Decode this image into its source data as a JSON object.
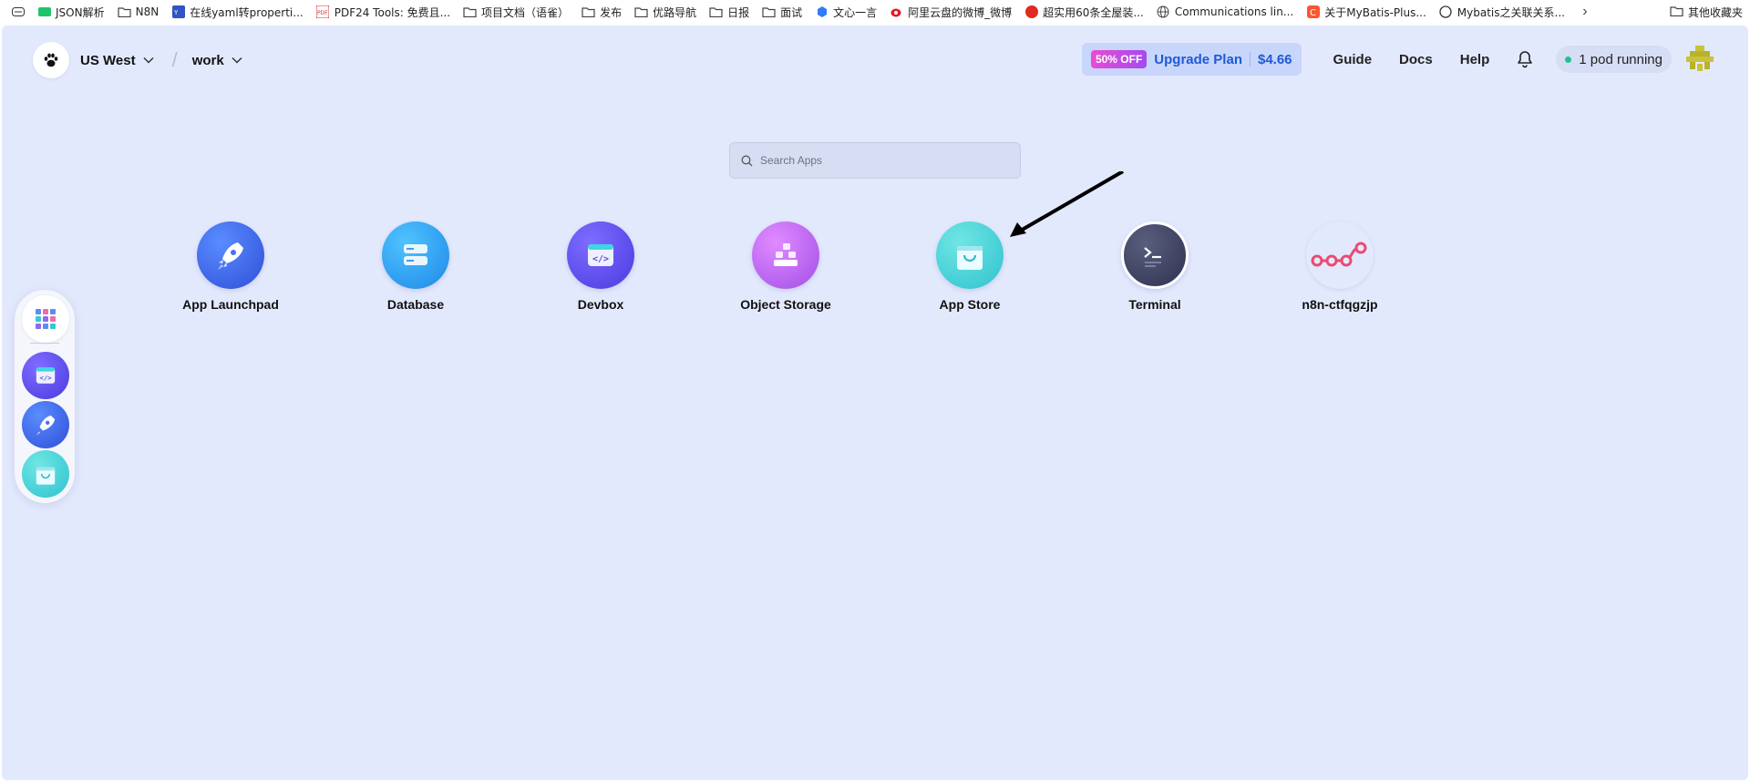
{
  "bookmarks": {
    "items": [
      {
        "label": "JSON解析",
        "icon": "green-badge-icon"
      },
      {
        "label": "N8N",
        "icon": "folder-icon"
      },
      {
        "label": "在线yaml转properti...",
        "icon": "blue-tool-icon"
      },
      {
        "label": "PDF24 Tools: 免费且...",
        "icon": "pdf24-icon"
      },
      {
        "label": "项目文档（语雀）",
        "icon": "folder-icon"
      },
      {
        "label": "发布",
        "icon": "folder-icon"
      },
      {
        "label": "优路导航",
        "icon": "folder-icon"
      },
      {
        "label": "日报",
        "icon": "folder-icon"
      },
      {
        "label": "面试",
        "icon": "folder-icon"
      },
      {
        "label": "文心一言",
        "icon": "wenxin-icon"
      },
      {
        "label": "阿里云盘的微博_微博",
        "icon": "weibo-icon"
      },
      {
        "label": "超实用60条全屋装...",
        "icon": "red-circle-icon"
      },
      {
        "label": "Communications lin...",
        "icon": "globe-icon"
      },
      {
        "label": "关于MyBatis-Plus...",
        "icon": "csdn-icon"
      },
      {
        "label": "Mybatis之关联关系...",
        "icon": "github-icon"
      }
    ],
    "more_icon": "chevron-right-icon",
    "other_label": "其他收藏夹"
  },
  "header": {
    "region": "US West",
    "workspace": "work",
    "upgrade": {
      "badge": "50% OFF",
      "label": "Upgrade Plan",
      "price": "$4.66"
    },
    "links": [
      "Guide",
      "Docs",
      "Help"
    ],
    "pod_status": "1 pod running"
  },
  "search": {
    "placeholder": "Search Apps"
  },
  "apps": [
    {
      "label": "App Launchpad",
      "icon": "rocket-icon"
    },
    {
      "label": "Database",
      "icon": "database-icon"
    },
    {
      "label": "Devbox",
      "icon": "devbox-icon"
    },
    {
      "label": "Object Storage",
      "icon": "object-storage-icon"
    },
    {
      "label": "App Store",
      "icon": "shopping-bag-icon"
    },
    {
      "label": "Terminal",
      "icon": "terminal-icon"
    },
    {
      "label": "n8n-ctfqgzjp",
      "icon": "n8n-icon"
    }
  ],
  "dock": [
    "grid-icon",
    "devbox-icon",
    "rocket-icon",
    "shopping-bag-icon"
  ],
  "colors": {
    "desktop_bg": "#e3e9fd",
    "accent": "#1f5ad6",
    "status": "#18c58f"
  }
}
